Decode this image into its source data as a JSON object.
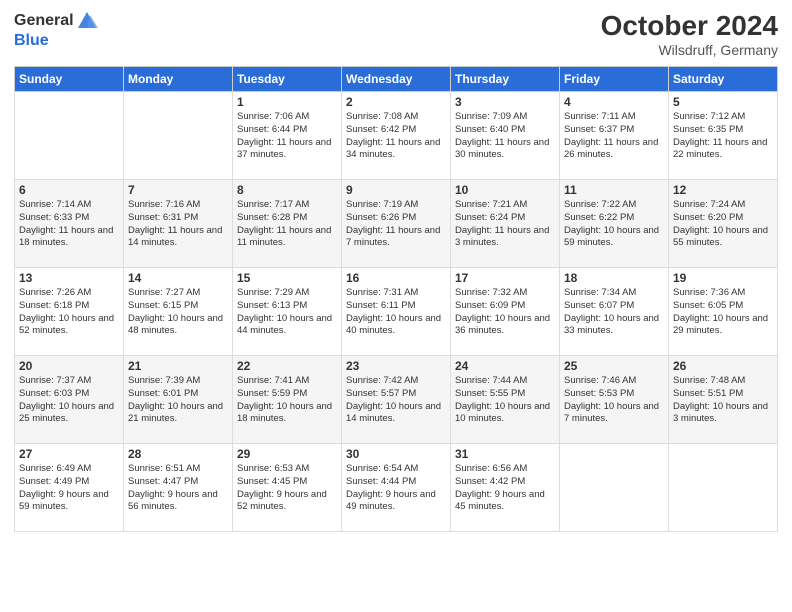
{
  "header": {
    "logo_general": "General",
    "logo_blue": "Blue",
    "month_title": "October 2024",
    "location": "Wilsdruff, Germany"
  },
  "days_of_week": [
    "Sunday",
    "Monday",
    "Tuesday",
    "Wednesday",
    "Thursday",
    "Friday",
    "Saturday"
  ],
  "weeks": [
    [
      {
        "day": "",
        "info": ""
      },
      {
        "day": "",
        "info": ""
      },
      {
        "day": "1",
        "info": "Sunrise: 7:06 AM\nSunset: 6:44 PM\nDaylight: 11 hours and 37 minutes."
      },
      {
        "day": "2",
        "info": "Sunrise: 7:08 AM\nSunset: 6:42 PM\nDaylight: 11 hours and 34 minutes."
      },
      {
        "day": "3",
        "info": "Sunrise: 7:09 AM\nSunset: 6:40 PM\nDaylight: 11 hours and 30 minutes."
      },
      {
        "day": "4",
        "info": "Sunrise: 7:11 AM\nSunset: 6:37 PM\nDaylight: 11 hours and 26 minutes."
      },
      {
        "day": "5",
        "info": "Sunrise: 7:12 AM\nSunset: 6:35 PM\nDaylight: 11 hours and 22 minutes."
      }
    ],
    [
      {
        "day": "6",
        "info": "Sunrise: 7:14 AM\nSunset: 6:33 PM\nDaylight: 11 hours and 18 minutes."
      },
      {
        "day": "7",
        "info": "Sunrise: 7:16 AM\nSunset: 6:31 PM\nDaylight: 11 hours and 14 minutes."
      },
      {
        "day": "8",
        "info": "Sunrise: 7:17 AM\nSunset: 6:28 PM\nDaylight: 11 hours and 11 minutes."
      },
      {
        "day": "9",
        "info": "Sunrise: 7:19 AM\nSunset: 6:26 PM\nDaylight: 11 hours and 7 minutes."
      },
      {
        "day": "10",
        "info": "Sunrise: 7:21 AM\nSunset: 6:24 PM\nDaylight: 11 hours and 3 minutes."
      },
      {
        "day": "11",
        "info": "Sunrise: 7:22 AM\nSunset: 6:22 PM\nDaylight: 10 hours and 59 minutes."
      },
      {
        "day": "12",
        "info": "Sunrise: 7:24 AM\nSunset: 6:20 PM\nDaylight: 10 hours and 55 minutes."
      }
    ],
    [
      {
        "day": "13",
        "info": "Sunrise: 7:26 AM\nSunset: 6:18 PM\nDaylight: 10 hours and 52 minutes."
      },
      {
        "day": "14",
        "info": "Sunrise: 7:27 AM\nSunset: 6:15 PM\nDaylight: 10 hours and 48 minutes."
      },
      {
        "day": "15",
        "info": "Sunrise: 7:29 AM\nSunset: 6:13 PM\nDaylight: 10 hours and 44 minutes."
      },
      {
        "day": "16",
        "info": "Sunrise: 7:31 AM\nSunset: 6:11 PM\nDaylight: 10 hours and 40 minutes."
      },
      {
        "day": "17",
        "info": "Sunrise: 7:32 AM\nSunset: 6:09 PM\nDaylight: 10 hours and 36 minutes."
      },
      {
        "day": "18",
        "info": "Sunrise: 7:34 AM\nSunset: 6:07 PM\nDaylight: 10 hours and 33 minutes."
      },
      {
        "day": "19",
        "info": "Sunrise: 7:36 AM\nSunset: 6:05 PM\nDaylight: 10 hours and 29 minutes."
      }
    ],
    [
      {
        "day": "20",
        "info": "Sunrise: 7:37 AM\nSunset: 6:03 PM\nDaylight: 10 hours and 25 minutes."
      },
      {
        "day": "21",
        "info": "Sunrise: 7:39 AM\nSunset: 6:01 PM\nDaylight: 10 hours and 21 minutes."
      },
      {
        "day": "22",
        "info": "Sunrise: 7:41 AM\nSunset: 5:59 PM\nDaylight: 10 hours and 18 minutes."
      },
      {
        "day": "23",
        "info": "Sunrise: 7:42 AM\nSunset: 5:57 PM\nDaylight: 10 hours and 14 minutes."
      },
      {
        "day": "24",
        "info": "Sunrise: 7:44 AM\nSunset: 5:55 PM\nDaylight: 10 hours and 10 minutes."
      },
      {
        "day": "25",
        "info": "Sunrise: 7:46 AM\nSunset: 5:53 PM\nDaylight: 10 hours and 7 minutes."
      },
      {
        "day": "26",
        "info": "Sunrise: 7:48 AM\nSunset: 5:51 PM\nDaylight: 10 hours and 3 minutes."
      }
    ],
    [
      {
        "day": "27",
        "info": "Sunrise: 6:49 AM\nSunset: 4:49 PM\nDaylight: 9 hours and 59 minutes."
      },
      {
        "day": "28",
        "info": "Sunrise: 6:51 AM\nSunset: 4:47 PM\nDaylight: 9 hours and 56 minutes."
      },
      {
        "day": "29",
        "info": "Sunrise: 6:53 AM\nSunset: 4:45 PM\nDaylight: 9 hours and 52 minutes."
      },
      {
        "day": "30",
        "info": "Sunrise: 6:54 AM\nSunset: 4:44 PM\nDaylight: 9 hours and 49 minutes."
      },
      {
        "day": "31",
        "info": "Sunrise: 6:56 AM\nSunset: 4:42 PM\nDaylight: 9 hours and 45 minutes."
      },
      {
        "day": "",
        "info": ""
      },
      {
        "day": "",
        "info": ""
      }
    ]
  ]
}
